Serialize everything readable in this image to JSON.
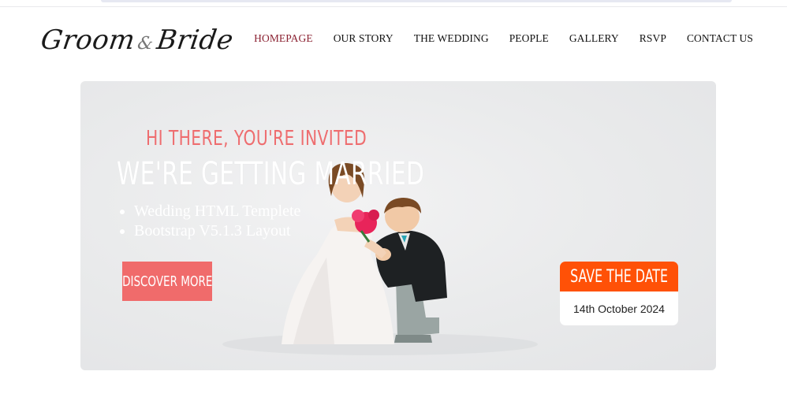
{
  "brand": {
    "logo_part1": "Groom",
    "logo_amp": "&",
    "logo_part2": "Bride"
  },
  "nav": {
    "items": [
      {
        "label": "HOMEPAGE",
        "active": true
      },
      {
        "label": "OUR STORY",
        "active": false
      },
      {
        "label": "THE WEDDING",
        "active": false
      },
      {
        "label": "PEOPLE",
        "active": false
      },
      {
        "label": "GALLERY",
        "active": false
      },
      {
        "label": "RSVP",
        "active": false
      },
      {
        "label": "CONTACT US",
        "active": false
      }
    ]
  },
  "hero": {
    "greeting": "HI THERE, YOU'RE INVITED",
    "headline": "WE'RE GETTING MARRIED",
    "features": [
      "Wedding HTML Templete",
      "Bootstrap V5.1.3 Layout"
    ],
    "cta_label": "DISCOVER MORE",
    "save_the_date": {
      "title": "SAVE THE DATE",
      "date": "14th October 2024"
    }
  },
  "colors": {
    "accent_coral": "#f06b6b",
    "greeting_pink": "#ee6d6f",
    "save_orange": "#ff5107",
    "nav_active": "#8b2232"
  }
}
